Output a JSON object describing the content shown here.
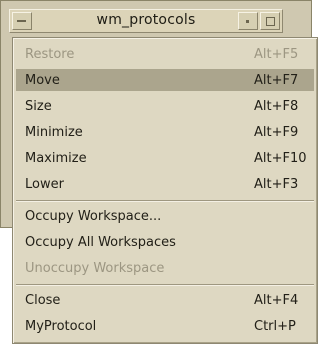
{
  "window": {
    "title": "wm_protocols"
  },
  "menu": {
    "items": [
      {
        "label": "Restore",
        "accel": "Alt+F5",
        "state": "disabled"
      },
      {
        "label": "Move",
        "accel": "Alt+F7",
        "state": "active"
      },
      {
        "label": "Size",
        "accel": "Alt+F8",
        "state": "normal"
      },
      {
        "label": "Minimize",
        "accel": "Alt+F9",
        "state": "normal"
      },
      {
        "label": "Maximize",
        "accel": "Alt+F10",
        "state": "normal"
      },
      {
        "label": "Lower",
        "accel": "Alt+F3",
        "state": "normal"
      },
      {
        "label": "Occupy Workspace...",
        "accel": "",
        "state": "normal"
      },
      {
        "label": "Occupy All Workspaces",
        "accel": "",
        "state": "normal"
      },
      {
        "label": "Unoccupy Workspace",
        "accel": "",
        "state": "disabled"
      },
      {
        "label": "Close",
        "accel": "Alt+F4",
        "state": "normal"
      },
      {
        "label": "MyProtocol",
        "accel": "Ctrl+P",
        "state": "normal"
      }
    ]
  },
  "colors": {
    "highlight": "#aba58d",
    "menu_bg": "#ded8c2",
    "frame": "#cfc8b0",
    "disabled_text": "#9c9682"
  }
}
